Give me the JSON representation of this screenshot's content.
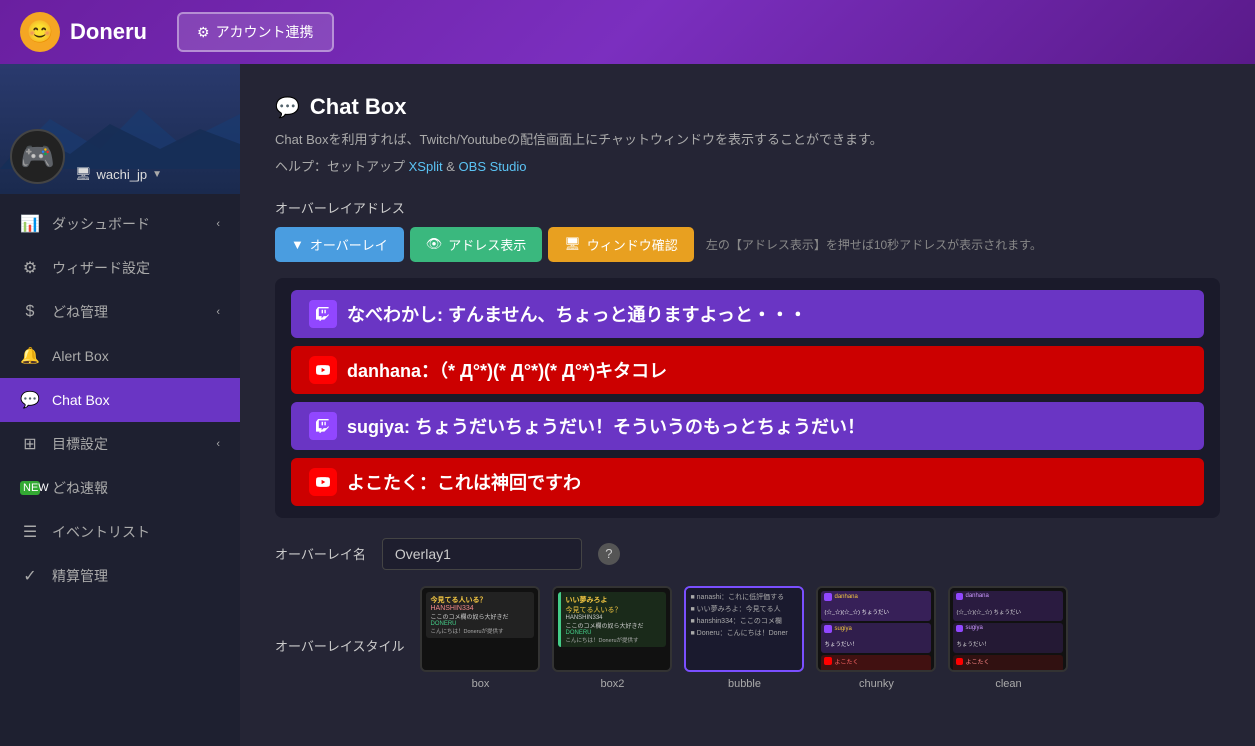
{
  "header": {
    "logo_icon": "😊",
    "logo_text": "Doneru",
    "account_btn_icon": "⚙",
    "account_btn_label": "アカウント連携"
  },
  "sidebar": {
    "user": {
      "avatar": "🎮",
      "username": "wachi_jp",
      "username_icon": "🖥"
    },
    "nav_items": [
      {
        "id": "dashboard",
        "icon": "📊",
        "label": "ダッシュボード",
        "has_chevron": true,
        "active": false
      },
      {
        "id": "wizard",
        "icon": "⚙",
        "label": "ウィザード設定",
        "has_chevron": false,
        "active": false
      },
      {
        "id": "done-management",
        "icon": "$",
        "label": "どね管理",
        "has_chevron": true,
        "active": false
      },
      {
        "id": "alert-box",
        "icon": "🔔",
        "label": "Alert Box",
        "has_chevron": false,
        "active": false
      },
      {
        "id": "chat-box",
        "icon": "💬",
        "label": "Chat Box",
        "has_chevron": false,
        "active": true
      },
      {
        "id": "mokuhyo",
        "icon": "⊞",
        "label": "目標設定",
        "has_chevron": true,
        "active": false
      },
      {
        "id": "done-sokuho",
        "icon": "▦",
        "label": "どね速報",
        "has_chevron": false,
        "active": false
      },
      {
        "id": "event-list",
        "icon": "☰",
        "label": "イベントリスト",
        "has_chevron": false,
        "active": false
      },
      {
        "id": "seisan",
        "icon": "✓",
        "label": "精算管理",
        "has_chevron": false,
        "active": false
      }
    ]
  },
  "content": {
    "page_title": "Chat Box",
    "page_title_icon": "💬",
    "desc_line1": "Chat Boxを利用すれば、Twitch/Youtubeの配信画面上にチャットウィンドウを表示することができます。",
    "desc_line2": "ヘルプ：セットアップ",
    "desc_link1": "XSplit",
    "desc_between": " & ",
    "desc_link2": "OBS Studio",
    "overlay_address_label": "オーバーレイアドレス",
    "tabs": [
      {
        "id": "overlay",
        "label": "オーバーレイ",
        "style": "blue",
        "icon": "▼"
      },
      {
        "id": "address-display",
        "label": "アドレス表示",
        "style": "green",
        "icon": "👁"
      },
      {
        "id": "window-confirm",
        "label": "ウィンドウ確認",
        "style": "orange",
        "icon": "🖥"
      }
    ],
    "tab_hint": "左の【アドレス表示】を押せば10秒アドレスが表示されます。",
    "chat_messages": [
      {
        "platform": "twitch",
        "text": "なべわかし: すんません、ちょっと通りますよっと・・・"
      },
      {
        "platform": "youtube",
        "text": "danhana：（* Д°*)(* Д°*)(* Д°*)キタコレ"
      },
      {
        "platform": "twitch",
        "text": "sugiya: ちょうだいちょうだい！そういうのもっとちょうだい！"
      },
      {
        "platform": "youtube",
        "text": "よこたく：これは神回ですわ"
      }
    ],
    "overlay_name_label": "オーバーレイ名",
    "overlay_name_value": "Overlay1",
    "overlay_styles_label": "オーバーレイスタイル",
    "style_cards": [
      {
        "id": "box",
        "name": "box",
        "selected": false
      },
      {
        "id": "box2",
        "name": "box2",
        "selected": false
      },
      {
        "id": "bubble",
        "name": "bubble",
        "selected": true
      },
      {
        "id": "chunky",
        "name": "chunky",
        "selected": false
      },
      {
        "id": "clean",
        "name": "clean",
        "selected": false
      }
    ]
  }
}
